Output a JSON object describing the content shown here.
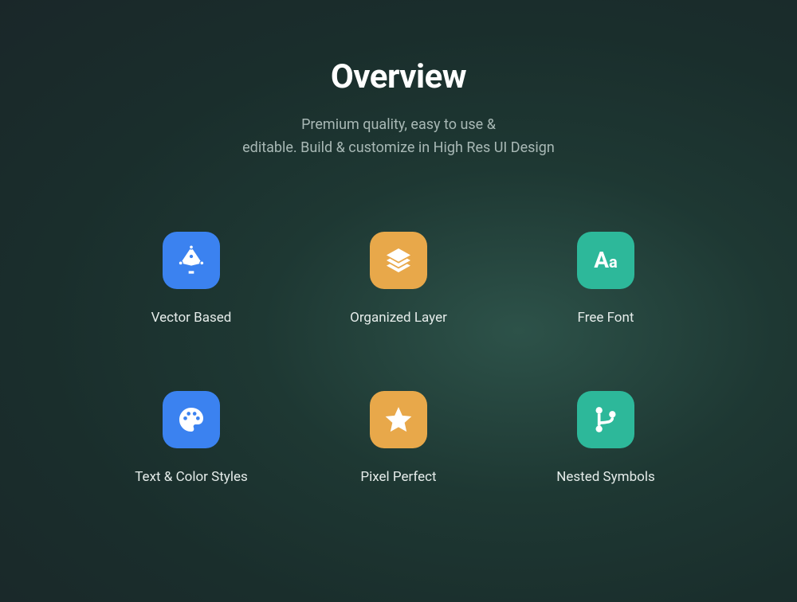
{
  "header": {
    "title": "Overview",
    "subtitle": "Premium quality, easy to use &\neditable. Build & customize in High Res UI Design"
  },
  "features": [
    {
      "label": "Vector Based",
      "color": "blue",
      "icon": "pen-tool"
    },
    {
      "label": "Organized Layer",
      "color": "orange",
      "icon": "layers"
    },
    {
      "label": "Free Font",
      "color": "teal",
      "icon": "font-aa"
    },
    {
      "label": "Text & Color Styles",
      "color": "blue",
      "icon": "palette"
    },
    {
      "label": "Pixel Perfect",
      "color": "orange",
      "icon": "star"
    },
    {
      "label": "Nested Symbols",
      "color": "teal",
      "icon": "git-branch"
    }
  ]
}
